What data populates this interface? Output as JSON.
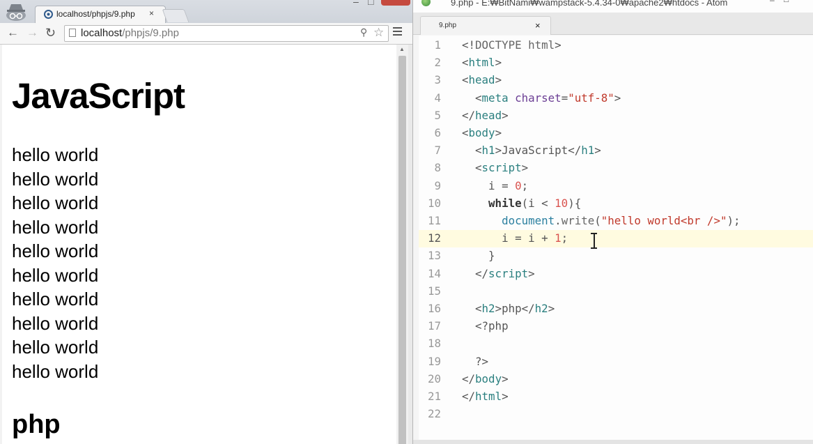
{
  "browser": {
    "tab": {
      "title": "localhost/phpjs/9.php",
      "close": "×"
    },
    "url": {
      "host": "localhost",
      "path": "/phpjs/9.php"
    },
    "buttons": {
      "back": "←",
      "forward": "→",
      "reload": "↻",
      "zoom": "⚲",
      "bookmark": "☆"
    },
    "page": {
      "heading1": "JavaScript",
      "lines": [
        "hello world",
        "hello world",
        "hello world",
        "hello world",
        "hello world",
        "hello world",
        "hello world",
        "hello world",
        "hello world",
        "hello world"
      ],
      "heading2": "php"
    }
  },
  "atom": {
    "window_title": "9.php - E:₩BitNami₩wampstack-5.4.34-0₩apache2₩htdocs - Atom",
    "tab": {
      "title": "9.php",
      "close": "×"
    },
    "current_line": 12,
    "lines": [
      {
        "n": "1",
        "tokens": [
          [
            "punc",
            "<!"
          ],
          [
            "dim",
            "DOCTYPE html"
          ],
          [
            "punc",
            ">"
          ]
        ]
      },
      {
        "n": "2",
        "tokens": [
          [
            "punc",
            "<"
          ],
          [
            "tag",
            "html"
          ],
          [
            "punc",
            ">"
          ]
        ]
      },
      {
        "n": "3",
        "tokens": [
          [
            "punc",
            "<"
          ],
          [
            "tag",
            "head"
          ],
          [
            "punc",
            ">"
          ]
        ]
      },
      {
        "n": "4",
        "tokens": [
          [
            "punc",
            "  <"
          ],
          [
            "tag",
            "meta"
          ],
          [
            "punc",
            " "
          ],
          [
            "attr",
            "charset"
          ],
          [
            "punc",
            "="
          ],
          [
            "str",
            "\"utf-8\""
          ],
          [
            "punc",
            ">"
          ]
        ]
      },
      {
        "n": "5",
        "tokens": [
          [
            "punc",
            "</"
          ],
          [
            "tag",
            "head"
          ],
          [
            "punc",
            ">"
          ]
        ]
      },
      {
        "n": "6",
        "tokens": [
          [
            "punc",
            "<"
          ],
          [
            "tag",
            "body"
          ],
          [
            "punc",
            ">"
          ]
        ]
      },
      {
        "n": "7",
        "tokens": [
          [
            "punc",
            "  <"
          ],
          [
            "tag",
            "h1"
          ],
          [
            "punc",
            ">JavaScript</"
          ],
          [
            "tag",
            "h1"
          ],
          [
            "punc",
            ">"
          ]
        ]
      },
      {
        "n": "8",
        "tokens": [
          [
            "punc",
            "  <"
          ],
          [
            "tag",
            "script"
          ],
          [
            "punc",
            ">"
          ]
        ]
      },
      {
        "n": "9",
        "tokens": [
          [
            "punc",
            "    i = "
          ],
          [
            "num",
            "0"
          ],
          [
            "punc",
            ";"
          ]
        ]
      },
      {
        "n": "10",
        "tokens": [
          [
            "punc",
            "    "
          ],
          [
            "kw",
            "while"
          ],
          [
            "punc",
            "(i < "
          ],
          [
            "num",
            "10"
          ],
          [
            "punc",
            "){"
          ]
        ]
      },
      {
        "n": "11",
        "tokens": [
          [
            "punc",
            "      "
          ],
          [
            "obj",
            "document"
          ],
          [
            "punc",
            "."
          ],
          [
            "dim",
            "write"
          ],
          [
            "punc",
            "("
          ],
          [
            "str",
            "\"hello world<br />\""
          ],
          [
            "punc",
            ");"
          ]
        ]
      },
      {
        "n": "12",
        "tokens": [
          [
            "punc",
            "      i = i + "
          ],
          [
            "num",
            "1"
          ],
          [
            "punc",
            ";"
          ]
        ]
      },
      {
        "n": "13",
        "tokens": [
          [
            "punc",
            "    }"
          ]
        ]
      },
      {
        "n": "14",
        "tokens": [
          [
            "punc",
            "  </"
          ],
          [
            "tag",
            "script"
          ],
          [
            "punc",
            ">"
          ]
        ]
      },
      {
        "n": "15",
        "tokens": []
      },
      {
        "n": "16",
        "tokens": [
          [
            "punc",
            "  <"
          ],
          [
            "tag",
            "h2"
          ],
          [
            "punc",
            ">php</"
          ],
          [
            "tag",
            "h2"
          ],
          [
            "punc",
            ">"
          ]
        ]
      },
      {
        "n": "17",
        "tokens": [
          [
            "punc",
            "  <?php"
          ]
        ]
      },
      {
        "n": "18",
        "tokens": []
      },
      {
        "n": "19",
        "tokens": [
          [
            "punc",
            "  ?>"
          ]
        ]
      },
      {
        "n": "20",
        "tokens": [
          [
            "punc",
            "</"
          ],
          [
            "tag",
            "body"
          ],
          [
            "punc",
            ">"
          ]
        ]
      },
      {
        "n": "21",
        "tokens": [
          [
            "punc",
            "</"
          ],
          [
            "tag",
            "html"
          ],
          [
            "punc",
            ">"
          ]
        ]
      },
      {
        "n": "22",
        "tokens": []
      }
    ]
  }
}
